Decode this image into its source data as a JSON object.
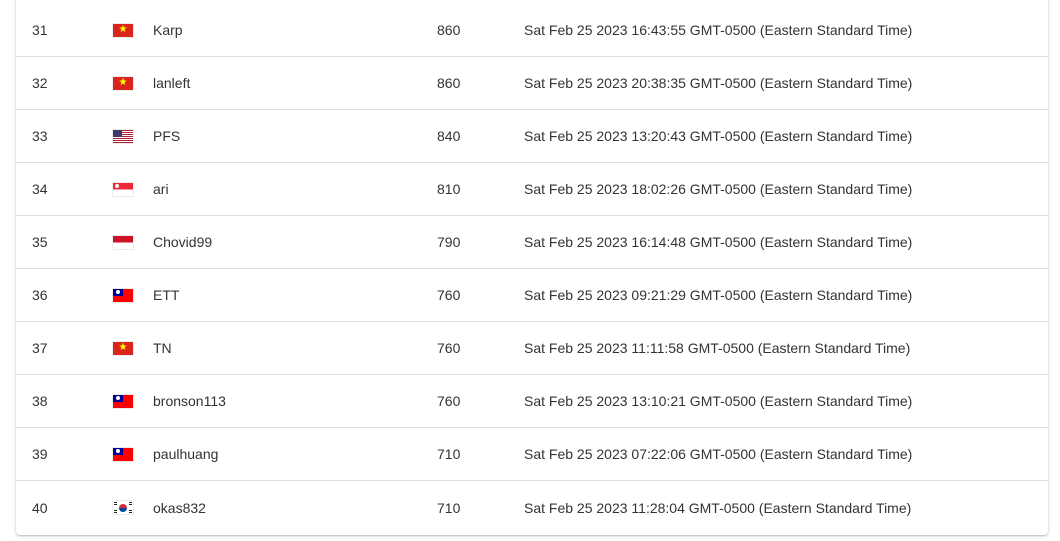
{
  "colors": {
    "text": "#333333",
    "divider": "#e0e0e0",
    "background": "#ffffff"
  },
  "scoreboard": {
    "rows": [
      {
        "rank": "31",
        "flag": "vietnam-flag-icon",
        "team": "Karp",
        "score": "860",
        "time": "Sat Feb 25 2023 16:43:55 GMT-0500 (Eastern Standard Time)"
      },
      {
        "rank": "32",
        "flag": "vietnam-flag-icon",
        "team": "lanleft",
        "score": "860",
        "time": "Sat Feb 25 2023 20:38:35 GMT-0500 (Eastern Standard Time)"
      },
      {
        "rank": "33",
        "flag": "usa-flag-icon",
        "team": "PFS",
        "score": "840",
        "time": "Sat Feb 25 2023 13:20:43 GMT-0500 (Eastern Standard Time)"
      },
      {
        "rank": "34",
        "flag": "singapore-flag-icon",
        "team": "ari",
        "score": "810",
        "time": "Sat Feb 25 2023 18:02:26 GMT-0500 (Eastern Standard Time)"
      },
      {
        "rank": "35",
        "flag": "indonesia-flag-icon",
        "team": "Chovid99",
        "score": "790",
        "time": "Sat Feb 25 2023 16:14:48 GMT-0500 (Eastern Standard Time)"
      },
      {
        "rank": "36",
        "flag": "taiwan-flag-icon",
        "team": "ETT",
        "score": "760",
        "time": "Sat Feb 25 2023 09:21:29 GMT-0500 (Eastern Standard Time)"
      },
      {
        "rank": "37",
        "flag": "vietnam-flag-icon",
        "team": "TN",
        "score": "760",
        "time": "Sat Feb 25 2023 11:11:58 GMT-0500 (Eastern Standard Time)"
      },
      {
        "rank": "38",
        "flag": "taiwan-flag-icon",
        "team": "bronson113",
        "score": "760",
        "time": "Sat Feb 25 2023 13:10:21 GMT-0500 (Eastern Standard Time)"
      },
      {
        "rank": "39",
        "flag": "taiwan-flag-icon",
        "team": "paulhuang",
        "score": "710",
        "time": "Sat Feb 25 2023 07:22:06 GMT-0500 (Eastern Standard Time)"
      },
      {
        "rank": "40",
        "flag": "south-korea-flag-icon",
        "team": "okas832",
        "score": "710",
        "time": "Sat Feb 25 2023 11:28:04 GMT-0500 (Eastern Standard Time)"
      }
    ]
  }
}
